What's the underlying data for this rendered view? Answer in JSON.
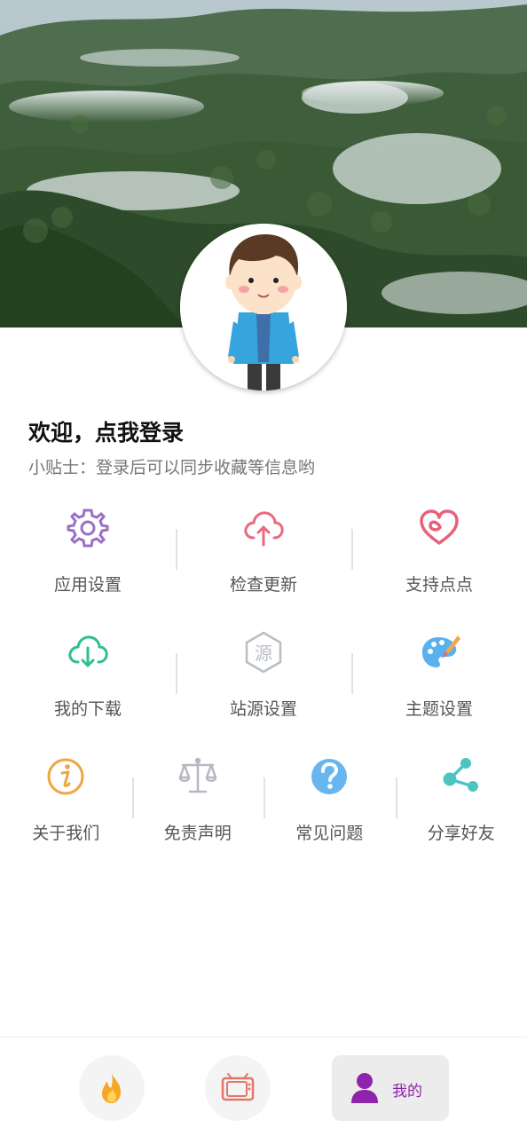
{
  "profile": {
    "welcome": "欢迎，点我登录",
    "tip": "小贴士：登录后可以同步收藏等信息哟"
  },
  "menu": {
    "row1": [
      {
        "label": "应用设置",
        "icon": "gear-icon",
        "color": "#9b6fc5"
      },
      {
        "label": "检查更新",
        "icon": "cloud-upload-icon",
        "color": "#e86a7e"
      },
      {
        "label": "支持点点",
        "icon": "heart-icon",
        "color": "#e8607a"
      }
    ],
    "row2": [
      {
        "label": "我的下载",
        "icon": "cloud-download-icon",
        "color": "#2ec08c"
      },
      {
        "label": "站源设置",
        "icon": "source-hexagon-icon",
        "color": "#b9bec6",
        "glyph": "源"
      },
      {
        "label": "主题设置",
        "icon": "palette-icon",
        "color": "#5ab1ec"
      }
    ],
    "row3": [
      {
        "label": "关于我们",
        "icon": "info-icon",
        "color": "#f0a640"
      },
      {
        "label": "免责声明",
        "icon": "scales-icon",
        "color": "#b7b7c3"
      },
      {
        "label": "常见问题",
        "icon": "question-icon",
        "color": "#68b6f0"
      },
      {
        "label": "分享好友",
        "icon": "share-icon",
        "color": "#4cc5c0"
      }
    ]
  },
  "bottom_nav": {
    "items": [
      {
        "icon": "flame-icon",
        "color": "#f5a623"
      },
      {
        "icon": "tv-icon",
        "color": "#e4756a"
      },
      {
        "icon": "user-icon",
        "label": "我的",
        "color": "#8e24aa",
        "active": true
      }
    ]
  }
}
